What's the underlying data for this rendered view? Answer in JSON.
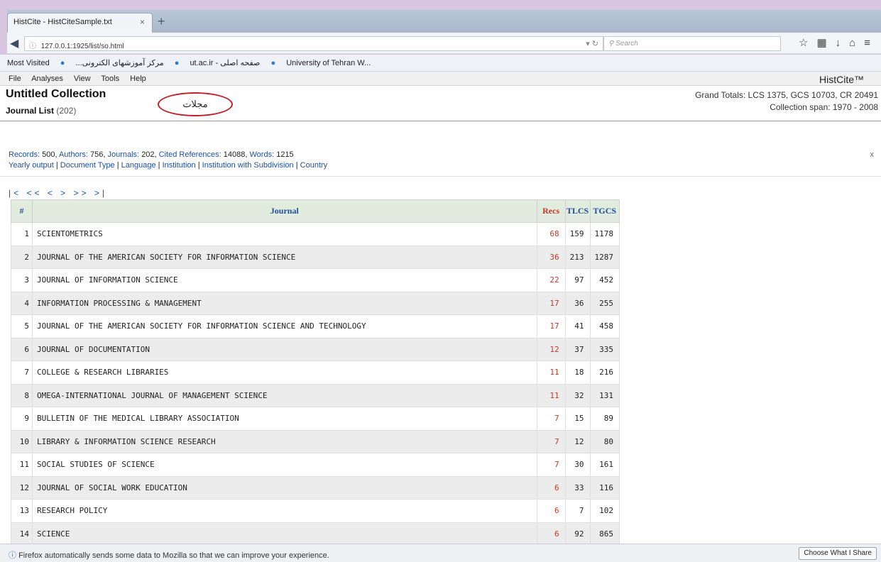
{
  "browser": {
    "tab_title": "HistCite - HistCiteSample.txt",
    "tab_close": "×",
    "new_tab": "+",
    "url": "127.0.0.1:1925/list/so.html",
    "search_placeholder": "Search",
    "bookmarks": [
      "Most Visited",
      "...مرکز آموزشهای الکترونی",
      "ut.ac.ir - صفحه اصلی",
      "University of Tehran W..."
    ]
  },
  "menu": [
    "File",
    "Analyses",
    "View",
    "Tools",
    "Help"
  ],
  "brand": "HistCite™",
  "header": {
    "collection_title": "Untitled Collection",
    "list_title": "Journal List",
    "list_count": "(202)",
    "grand_totals": "Grand Totals: LCS 1375, GCS 10703, CR 20491",
    "collection_span": "Collection span: 1970 - 2008",
    "callout": "مجلات"
  },
  "summary": {
    "records_label": "Records:",
    "records_value": "500,",
    "authors_label": "Authors:",
    "authors_value": "756,",
    "journals_label": "Journals:",
    "journals_value": "202,",
    "cited_label": "Cited References:",
    "cited_value": "14088,",
    "words_label": "Words:",
    "words_value": "1215",
    "links": [
      "Yearly output",
      "Document Type",
      "Language",
      "Institution",
      "Institution with Subdivision",
      "Country"
    ],
    "close": "x"
  },
  "pager": "|< << < > >> >|",
  "table": {
    "headers": [
      "#",
      "Journal",
      "Recs",
      "TLCS",
      "TGCS"
    ],
    "rows": [
      [
        "1",
        "SCIENTOMETRICS",
        "68",
        "159",
        "1178"
      ],
      [
        "2",
        "JOURNAL OF THE AMERICAN SOCIETY FOR INFORMATION SCIENCE",
        "36",
        "213",
        "1287"
      ],
      [
        "3",
        "JOURNAL OF INFORMATION SCIENCE",
        "22",
        "97",
        "452"
      ],
      [
        "4",
        "INFORMATION PROCESSING & MANAGEMENT",
        "17",
        "36",
        "255"
      ],
      [
        "5",
        "JOURNAL OF THE AMERICAN SOCIETY FOR INFORMATION SCIENCE AND TECHNOLOGY",
        "17",
        "41",
        "458"
      ],
      [
        "6",
        "JOURNAL OF DOCUMENTATION",
        "12",
        "37",
        "335"
      ],
      [
        "7",
        "COLLEGE & RESEARCH LIBRARIES",
        "11",
        "18",
        "216"
      ],
      [
        "8",
        "OMEGA-INTERNATIONAL JOURNAL OF MANAGEMENT SCIENCE",
        "11",
        "32",
        "131"
      ],
      [
        "9",
        "BULLETIN OF THE MEDICAL LIBRARY ASSOCIATION",
        "7",
        "15",
        "89"
      ],
      [
        "10",
        "LIBRARY & INFORMATION SCIENCE RESEARCH",
        "7",
        "12",
        "80"
      ],
      [
        "11",
        "SOCIAL STUDIES OF SCIENCE",
        "7",
        "30",
        "161"
      ],
      [
        "12",
        "JOURNAL OF SOCIAL WORK EDUCATION",
        "6",
        "33",
        "116"
      ],
      [
        "13",
        "RESEARCH POLICY",
        "6",
        "7",
        "102"
      ],
      [
        "14",
        "SCIENCE",
        "6",
        "92",
        "865"
      ]
    ]
  },
  "notification": {
    "text": "Firefox automatically sends some data to Mozilla so that we can improve your experience.",
    "button": "Choose What I Share"
  }
}
